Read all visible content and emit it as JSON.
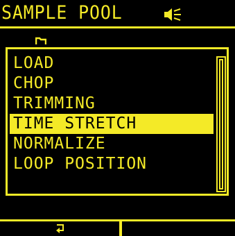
{
  "header": {
    "title": "SAMPLE POOL",
    "speaker_icon": "speaker-muted-icon"
  },
  "folder": {
    "icon": "folder-icon"
  },
  "menu": {
    "items": [
      {
        "label": "LOAD",
        "selected": false
      },
      {
        "label": "CHOP",
        "selected": false
      },
      {
        "label": "TRIMMING",
        "selected": false
      },
      {
        "label": "TIME STRETCH",
        "selected": true
      },
      {
        "label": "NORMALIZE",
        "selected": false
      },
      {
        "label": "LOOP POSITION",
        "selected": false
      }
    ],
    "scroll_fraction_visible": 1.0
  },
  "softkeys": {
    "key1_icon": "return-arrow-icon",
    "key2_icon": ""
  },
  "colors": {
    "foreground": "#f4ea27",
    "background": "#000000"
  }
}
